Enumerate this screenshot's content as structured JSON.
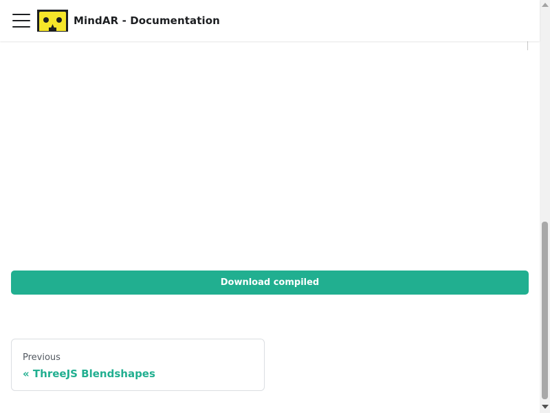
{
  "navbar": {
    "title": "MindAR - Documentation",
    "menu_icon": "hamburger-menu-icon",
    "logo_icon": "vr-headset-logo-icon"
  },
  "main": {
    "download_button_label": "Download compiled"
  },
  "pagination": {
    "previous": {
      "sublabel": "Previous",
      "label": "« ThreeJS Blendshapes"
    }
  },
  "colors": {
    "accent": "#21af90",
    "logo_yellow": "#f5e52a",
    "text_dark": "#1c1e21",
    "border": "#dadde1"
  }
}
